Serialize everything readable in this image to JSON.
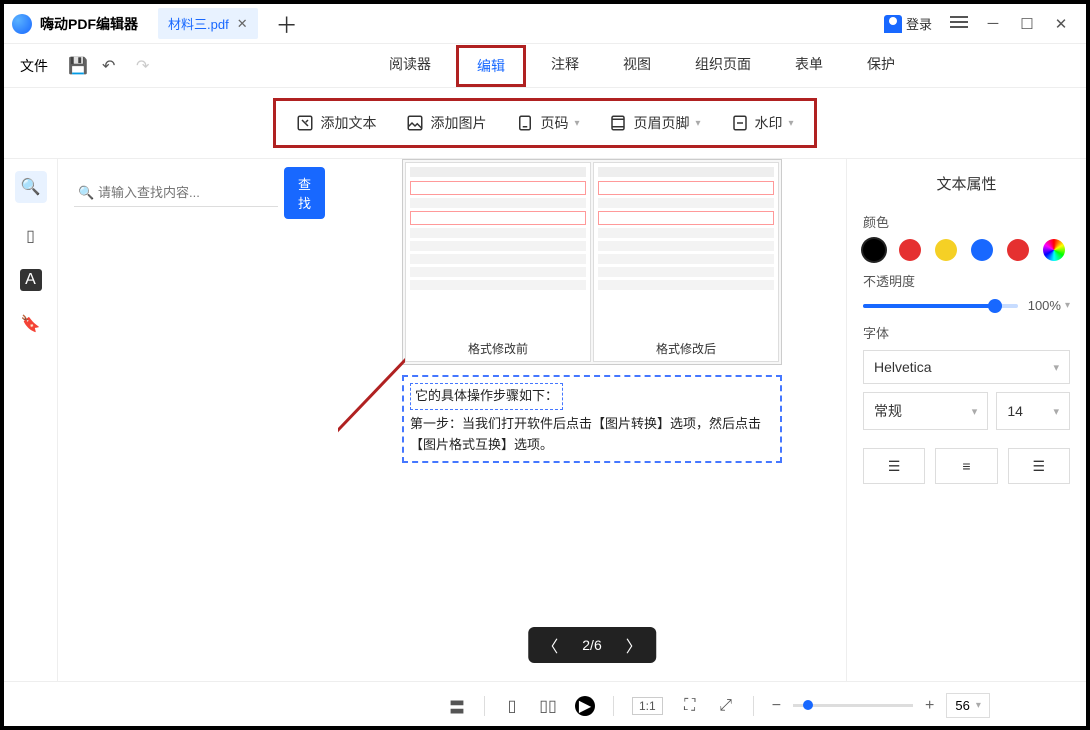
{
  "app": {
    "title": "嗨动PDF编辑器",
    "tab_name": "材料三.pdf",
    "login": "登录"
  },
  "menu": {
    "file": "文件"
  },
  "main_tabs": {
    "reader": "阅读器",
    "edit": "编辑",
    "annotate": "注释",
    "view": "视图",
    "organize": "组织页面",
    "form": "表单",
    "protect": "保护"
  },
  "edit_tools": {
    "add_text": "添加文本",
    "add_image": "添加图片",
    "page_number": "页码",
    "header_footer": "页眉页脚",
    "watermark": "水印"
  },
  "search": {
    "placeholder": "请输入查找内容...",
    "find": "查找"
  },
  "doc": {
    "before_caption": "格式修改前",
    "after_caption": "格式修改后",
    "step_title": "它的具体操作步骤如下：",
    "step_body": "第一步：当我们打开软件后点击【图片转换】选项，然后点击【图片格式互换】选项。"
  },
  "pager": {
    "label": "2/6"
  },
  "right": {
    "title": "文本属性",
    "color_label": "颜色",
    "opacity_label": "不透明度",
    "opacity_value": "100%",
    "font_label": "字体",
    "font_family": "Helvetica",
    "font_style": "常规",
    "font_size": "14",
    "colors": [
      "#000000",
      "#e53030",
      "#f5d025",
      "#1868ff",
      "#e53030"
    ]
  },
  "status": {
    "ratio": "1:1",
    "zoom": "56"
  }
}
